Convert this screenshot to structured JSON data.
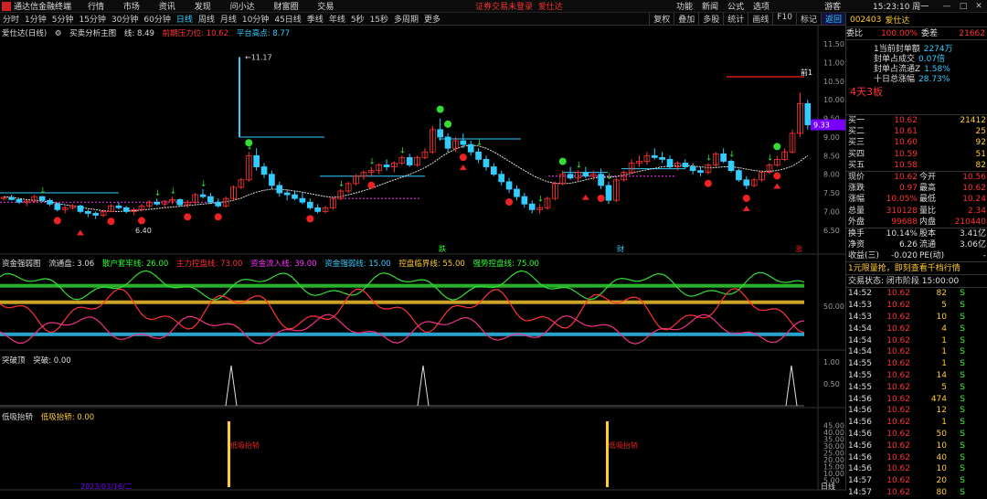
{
  "titlebar": {
    "app_name": "通达信金融终端",
    "menu": [
      "行情",
      "市场",
      "资讯",
      "发现",
      "问小达",
      "财富圈",
      "交易"
    ],
    "warning": "证券交易未登录",
    "warning_stock": "爱仕达",
    "tools": [
      "功能",
      "新闻",
      "公式",
      "选项",
      "游客"
    ],
    "time": "15:23:10 周一"
  },
  "toolbar": {
    "periods": [
      "分时",
      "1分钟",
      "5分钟",
      "15分钟",
      "30分钟",
      "60分钟",
      "日线",
      "周线",
      "月线",
      "10分钟",
      "45日线",
      "季线",
      "年线",
      "5秒",
      "15秒",
      "多周期",
      "更多"
    ],
    "active_period": 6,
    "right_tools": [
      "复权",
      "叠加",
      "多股",
      "统计",
      "画线",
      "F10",
      "标记",
      "返回"
    ],
    "active_right": 7
  },
  "main_legend": {
    "stock": "爱仕达(日线)",
    "indicator": "买卖分析主图",
    "line_label": "线: 8.49",
    "pressure": "前期压力位: 10.62",
    "platform": "平台高点: 8.77"
  },
  "main_axis": [
    "11.50",
    "11.00",
    "10.50",
    "10.00",
    "9.50",
    "9.00",
    "8.50",
    "8.00",
    "7.50",
    "7.00",
    "6.50"
  ],
  "main_annotations": {
    "high_label": "11.17",
    "low_label": "6.40",
    "current_price": "9.33",
    "right_marker": "前1"
  },
  "marks_row": [
    "跌",
    "财",
    "涨"
  ],
  "osc_legend": [
    "资金强弱图",
    "流通盘: 3.06",
    "散户套牢线: 26.00",
    "主力控盘线: 73.00",
    "资金流入线: 39.00",
    "资金强弱线: 15.00",
    "控盘临界线: 55.00",
    "强势控盘线: 75.00"
  ],
  "osc_axis": [
    "50.00"
  ],
  "break_legend": [
    "突破顶",
    "突破: 0.00"
  ],
  "break_axis": [
    "1.00",
    "0.50"
  ],
  "low_legend": [
    "低吸抬轿",
    "低吸抬轿: 0.00"
  ],
  "low_axis": [
    "45.00",
    "40.00",
    "35.00",
    "30.00",
    "25.00",
    "20.00",
    "15.00",
    "10.00",
    "5.00"
  ],
  "low_bar_label": "低吸抬轿",
  "bottom_date": "2023/03/16/二",
  "bottom_right": "日线",
  "colors": {
    "up": "#ff3333",
    "down": "#33ccff",
    "ma": "#dddddd",
    "green": "#33dd33",
    "pink": "#ee3388",
    "yellow": "#ffcc33",
    "white": "#dddddd"
  },
  "chart_data": {
    "type": "candlestick",
    "price_range": [
      6.2,
      11.7
    ],
    "candles": [
      [
        7.35,
        7.4,
        7.3,
        7.38
      ],
      [
        7.38,
        7.45,
        7.3,
        7.32
      ],
      [
        7.32,
        7.35,
        7.2,
        7.25
      ],
      [
        7.25,
        7.3,
        7.15,
        7.28
      ],
      [
        7.28,
        7.45,
        7.25,
        7.4
      ],
      [
        7.4,
        7.42,
        7.25,
        7.3
      ],
      [
        7.3,
        7.35,
        7.15,
        7.2
      ],
      [
        7.2,
        7.25,
        7.0,
        7.05
      ],
      [
        7.05,
        7.15,
        6.95,
        7.1
      ],
      [
        7.1,
        7.2,
        7.05,
        7.15
      ],
      [
        7.15,
        7.18,
        6.95,
        7.0
      ],
      [
        7.0,
        7.05,
        6.85,
        6.95
      ],
      [
        6.95,
        7.0,
        6.8,
        6.9
      ],
      [
        6.9,
        7.05,
        6.85,
        7.0
      ],
      [
        7.0,
        7.2,
        6.98,
        7.15
      ],
      [
        7.15,
        7.25,
        7.05,
        7.1
      ],
      [
        7.1,
        7.15,
        6.95,
        7.0
      ],
      [
        7.0,
        7.1,
        6.9,
        7.05
      ],
      [
        7.05,
        7.2,
        7.0,
        7.15
      ],
      [
        7.15,
        7.3,
        7.1,
        7.25
      ],
      [
        7.25,
        7.35,
        7.15,
        7.2
      ],
      [
        7.2,
        7.3,
        7.1,
        7.28
      ],
      [
        7.28,
        7.4,
        7.2,
        7.32
      ],
      [
        7.32,
        7.35,
        7.15,
        7.18
      ],
      [
        7.18,
        7.3,
        7.1,
        7.25
      ],
      [
        7.25,
        7.5,
        7.2,
        7.45
      ],
      [
        7.45,
        7.6,
        7.35,
        7.4
      ],
      [
        7.4,
        7.5,
        7.2,
        7.25
      ],
      [
        7.25,
        7.35,
        7.1,
        7.15
      ],
      [
        7.15,
        7.4,
        7.1,
        7.35
      ],
      [
        7.35,
        7.7,
        7.3,
        7.65
      ],
      [
        7.65,
        7.9,
        7.6,
        7.85
      ],
      [
        7.85,
        8.6,
        7.8,
        8.5
      ],
      [
        8.5,
        8.7,
        8.1,
        8.2
      ],
      [
        8.2,
        8.3,
        7.9,
        8.0
      ],
      [
        8.0,
        8.1,
        7.6,
        7.7
      ],
      [
        7.7,
        7.8,
        7.4,
        7.5
      ],
      [
        7.5,
        7.6,
        7.3,
        7.45
      ],
      [
        7.45,
        7.55,
        7.3,
        7.35
      ],
      [
        7.35,
        7.5,
        7.2,
        7.25
      ],
      [
        7.25,
        7.35,
        7.05,
        7.1
      ],
      [
        7.1,
        7.2,
        6.95,
        7.0
      ],
      [
        7.0,
        7.15,
        6.95,
        7.1
      ],
      [
        7.1,
        7.4,
        7.05,
        7.35
      ],
      [
        7.35,
        7.6,
        7.3,
        7.55
      ],
      [
        7.55,
        7.8,
        7.5,
        7.75
      ],
      [
        7.75,
        8.0,
        7.7,
        7.95
      ],
      [
        7.95,
        8.1,
        7.85,
        8.05
      ],
      [
        8.05,
        8.2,
        7.95,
        8.1
      ],
      [
        8.1,
        8.3,
        8.0,
        8.25
      ],
      [
        8.25,
        8.4,
        8.1,
        8.2
      ],
      [
        8.2,
        8.35,
        8.05,
        8.3
      ],
      [
        8.3,
        8.5,
        8.25,
        8.45
      ],
      [
        8.45,
        8.55,
        8.2,
        8.25
      ],
      [
        8.25,
        8.5,
        8.2,
        8.45
      ],
      [
        8.45,
        8.7,
        8.4,
        8.6
      ],
      [
        8.6,
        9.3,
        8.55,
        9.2
      ],
      [
        9.2,
        9.5,
        8.9,
        9.0
      ],
      [
        9.0,
        9.1,
        8.6,
        8.7
      ],
      [
        8.7,
        9.0,
        8.6,
        8.9
      ],
      [
        8.9,
        9.1,
        8.7,
        8.8
      ],
      [
        8.8,
        8.9,
        8.5,
        8.6
      ],
      [
        8.6,
        8.7,
        8.3,
        8.4
      ],
      [
        8.4,
        8.5,
        8.1,
        8.2
      ],
      [
        8.2,
        8.3,
        7.95,
        8.0
      ],
      [
        8.0,
        8.1,
        7.7,
        7.8
      ],
      [
        7.8,
        7.9,
        7.5,
        7.6
      ],
      [
        7.6,
        7.7,
        7.3,
        7.4
      ],
      [
        7.4,
        7.5,
        7.1,
        7.2
      ],
      [
        7.2,
        7.3,
        6.95,
        7.05
      ],
      [
        7.05,
        7.2,
        6.95,
        7.1
      ],
      [
        7.1,
        7.4,
        7.05,
        7.35
      ],
      [
        7.35,
        7.8,
        7.3,
        7.75
      ],
      [
        7.75,
        8.1,
        7.7,
        8.0
      ],
      [
        8.0,
        8.2,
        7.85,
        7.9
      ],
      [
        7.9,
        8.1,
        7.8,
        8.05
      ],
      [
        8.05,
        8.2,
        7.9,
        7.95
      ],
      [
        7.95,
        8.1,
        7.85,
        8.0
      ],
      [
        8.0,
        8.15,
        7.6,
        7.7
      ],
      [
        7.7,
        7.8,
        7.2,
        7.3
      ],
      [
        7.3,
        7.9,
        7.25,
        7.85
      ],
      [
        7.85,
        8.1,
        7.8,
        8.05
      ],
      [
        8.05,
        8.4,
        8.0,
        8.3
      ],
      [
        8.3,
        8.5,
        8.2,
        8.35
      ],
      [
        8.35,
        8.6,
        8.25,
        8.5
      ],
      [
        8.5,
        8.7,
        8.4,
        8.45
      ],
      [
        8.45,
        8.6,
        8.3,
        8.4
      ],
      [
        8.4,
        8.5,
        8.15,
        8.2
      ],
      [
        8.2,
        8.35,
        8.1,
        8.3
      ],
      [
        8.3,
        8.4,
        8.15,
        8.2
      ],
      [
        8.2,
        8.3,
        8.0,
        8.1
      ],
      [
        8.1,
        8.2,
        7.95,
        8.05
      ],
      [
        8.05,
        8.3,
        8.0,
        8.25
      ],
      [
        8.25,
        8.6,
        8.2,
        8.55
      ],
      [
        8.55,
        8.7,
        8.3,
        8.35
      ],
      [
        8.35,
        8.4,
        8.05,
        8.1
      ],
      [
        8.1,
        8.15,
        7.8,
        7.85
      ],
      [
        7.85,
        7.95,
        7.6,
        7.7
      ],
      [
        7.7,
        7.9,
        7.65,
        7.85
      ],
      [
        7.85,
        8.1,
        7.8,
        8.05
      ],
      [
        8.05,
        8.3,
        8.0,
        8.25
      ],
      [
        8.25,
        8.5,
        8.2,
        8.4
      ],
      [
        8.4,
        8.7,
        8.35,
        8.6
      ],
      [
        8.6,
        9.2,
        8.55,
        9.1
      ],
      [
        9.1,
        10.2,
        9.0,
        9.9
      ],
      [
        9.9,
        10.0,
        9.2,
        9.33
      ]
    ],
    "ma": [
      7.4,
      7.38,
      7.35,
      7.32,
      7.3,
      7.28,
      7.26,
      7.22,
      7.18,
      7.15,
      7.12,
      7.08,
      7.05,
      7.02,
      7.0,
      7.0,
      7.01,
      7.02,
      7.04,
      7.06,
      7.08,
      7.1,
      7.12,
      7.14,
      7.16,
      7.18,
      7.2,
      7.22,
      7.24,
      7.26,
      7.3,
      7.36,
      7.45,
      7.52,
      7.57,
      7.6,
      7.6,
      7.58,
      7.55,
      7.52,
      7.48,
      7.44,
      7.4,
      7.38,
      7.4,
      7.45,
      7.5,
      7.56,
      7.62,
      7.7,
      7.78,
      7.85,
      7.92,
      8.0,
      8.08,
      8.18,
      8.3,
      8.45,
      8.58,
      8.68,
      8.75,
      8.78,
      8.76,
      8.7,
      8.6,
      8.48,
      8.35,
      8.22,
      8.1,
      7.98,
      7.88,
      7.8,
      7.76,
      7.75,
      7.76,
      7.8,
      7.85,
      7.9,
      7.92,
      7.92,
      7.94,
      7.98,
      8.03,
      8.08,
      8.12,
      8.16,
      8.2,
      8.22,
      8.23,
      8.24,
      8.22,
      8.2,
      8.18,
      8.18,
      8.2,
      8.2,
      8.18,
      8.14,
      8.1,
      8.08,
      8.08,
      8.1,
      8.15,
      8.22,
      8.35,
      8.5
    ]
  },
  "right_panel": {
    "code": "002403",
    "name": "爱仕达",
    "weibi_label": "委比",
    "weibi_val": "100.00%",
    "weicha_label": "委差",
    "weicha_val": "21662",
    "seal_lines": [
      {
        "label": "1当前封单额",
        "value": "2274万"
      },
      {
        "label": "封单占成交",
        "value": "0.07倍"
      },
      {
        "label": "封单占流通Z",
        "value": "1.58%"
      },
      {
        "label": "十日总涨幅",
        "value": "28.73%"
      }
    ],
    "streak": "4天3板",
    "buys": [
      {
        "label": "买一",
        "price": "10.62",
        "vol": "21412"
      },
      {
        "label": "买二",
        "price": "10.61",
        "vol": "25"
      },
      {
        "label": "买三",
        "price": "10.60",
        "vol": "92"
      },
      {
        "label": "买四",
        "price": "10.59",
        "vol": "51"
      },
      {
        "label": "买五",
        "price": "10.58",
        "vol": "82"
      }
    ],
    "quote": [
      [
        "现价",
        "10.62",
        "今开",
        "10.56"
      ],
      [
        "涨跌",
        "0.97",
        "最高",
        "10.62"
      ],
      [
        "涨幅",
        "10.05%",
        "最低",
        "10.24"
      ],
      [
        "总量",
        "310128",
        "量比",
        "2.34"
      ],
      [
        "外盘",
        "99688",
        "内盘",
        "210440"
      ]
    ],
    "quote2": [
      [
        "换手",
        "10.14%",
        "股本",
        "3.41亿"
      ],
      [
        "净资",
        "6.26",
        "流通",
        "3.06亿"
      ],
      [
        "收益(三)",
        "-0.020",
        "PE(动)",
        "-"
      ]
    ],
    "promo": "1元限量抢，即刻查看千档行情",
    "trade_state": "交易状态: 闭市阶段 15:00:00",
    "ticks": [
      [
        "14:52",
        "10.62",
        "82",
        "S"
      ],
      [
        "14:53",
        "10.62",
        "5",
        "S"
      ],
      [
        "14:53",
        "10.62",
        "10",
        "S"
      ],
      [
        "14:54",
        "10.62",
        "4",
        "S"
      ],
      [
        "14:54",
        "10.62",
        "1",
        "S"
      ],
      [
        "14:54",
        "10.62",
        "1",
        "S"
      ],
      [
        "14:55",
        "10.62",
        "1",
        "S"
      ],
      [
        "14:55",
        "10.62",
        "14",
        "S"
      ],
      [
        "14:55",
        "10.62",
        "5",
        "S"
      ],
      [
        "14:56",
        "10.62",
        "474",
        "S"
      ],
      [
        "14:56",
        "10.62",
        "12",
        "S"
      ],
      [
        "14:56",
        "10.62",
        "1",
        "S"
      ],
      [
        "14:56",
        "10.62",
        "50",
        "S"
      ],
      [
        "14:56",
        "10.62",
        "10",
        "S"
      ],
      [
        "14:56",
        "10.62",
        "40",
        "S"
      ],
      [
        "14:56",
        "10.62",
        "10",
        "S"
      ],
      [
        "14:57",
        "10.62",
        "20",
        "S"
      ],
      [
        "14:57",
        "10.62",
        "80",
        "S"
      ]
    ]
  }
}
